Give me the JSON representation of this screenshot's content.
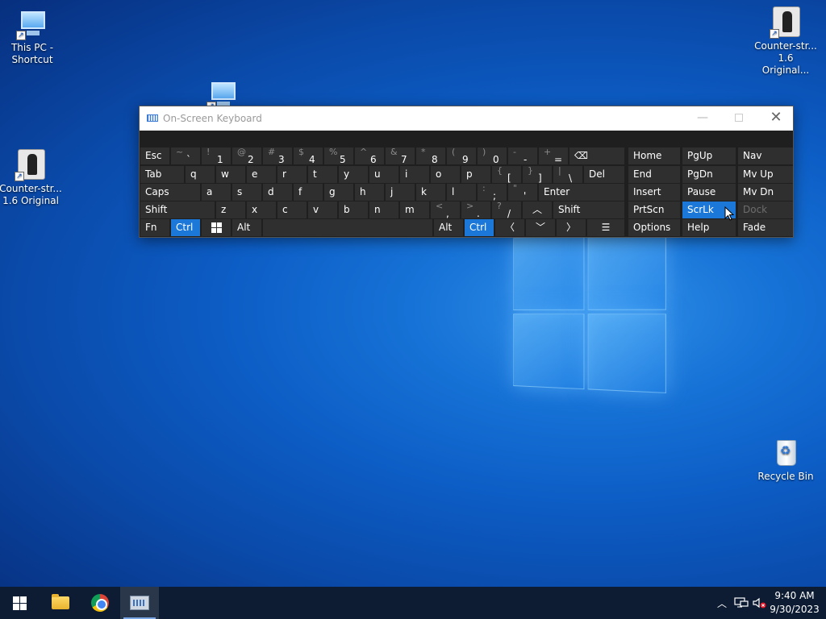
{
  "desktop": {
    "icons": [
      {
        "label": "This PC -\nShortcut"
      },
      {
        "label": "Counter-str...\n1.6 Original"
      },
      {
        "label": "Counter-str...\n1.6 Original..."
      },
      {
        "label": "Recycle Bin"
      }
    ]
  },
  "osk": {
    "title": "On-Screen Keyboard",
    "minimize_glyph": "—",
    "close_glyph": "✕",
    "keys": {
      "esc": "Esc",
      "tilde": {
        "sec": "~",
        "pri": "`"
      },
      "k1": {
        "sec": "!",
        "pri": "1"
      },
      "k2": {
        "sec": "@",
        "pri": "2"
      },
      "k3": {
        "sec": "#",
        "pri": "3"
      },
      "k4": {
        "sec": "$",
        "pri": "4"
      },
      "k5": {
        "sec": "%",
        "pri": "5"
      },
      "k6": {
        "sec": "^",
        "pri": "6"
      },
      "k7": {
        "sec": "&",
        "pri": "7"
      },
      "k8": {
        "sec": "*",
        "pri": "8"
      },
      "k9": {
        "sec": "(",
        "pri": "9"
      },
      "k0": {
        "sec": ")",
        "pri": "0"
      },
      "minus": {
        "sec": "-",
        "pri": "-"
      },
      "equals": {
        "sec": "+",
        "pri": "="
      },
      "backspace_glyph": "⌫",
      "tab": "Tab",
      "q": "q",
      "w": "w",
      "e": "e",
      "r": "r",
      "t": "t",
      "y": "y",
      "u": "u",
      "i": "i",
      "o": "o",
      "p": "p",
      "lbracket": {
        "sec": "{",
        "pri": "["
      },
      "rbracket": {
        "sec": "}",
        "pri": "]"
      },
      "backslash": {
        "sec": "|",
        "pri": "\\"
      },
      "del": "Del",
      "caps": "Caps",
      "a": "a",
      "s": "s",
      "d": "d",
      "f": "f",
      "g": "g",
      "h": "h",
      "j": "j",
      "k": "k",
      "l": "l",
      "semicolon": {
        "sec": ":",
        "pri": ";"
      },
      "quote": {
        "sec": "\"",
        "pri": "'"
      },
      "enter": "Enter",
      "shift_left": "Shift",
      "z": "z",
      "x": "x",
      "c": "c",
      "v": "v",
      "b": "b",
      "n": "n",
      "m": "m",
      "comma": {
        "sec": "<",
        "pri": ","
      },
      "period": {
        "sec": ">",
        "pri": "."
      },
      "slash": {
        "sec": "?",
        "pri": "/"
      },
      "up_glyph": "︿",
      "shift_right": "Shift",
      "fn": "Fn",
      "ctrl_left": "Ctrl",
      "alt_left": "Alt",
      "alt_right": "Alt",
      "ctrl_right": "Ctrl",
      "left_glyph": "〈",
      "down_glyph": "﹀",
      "right_glyph": "〉",
      "menu_glyph": "☰",
      "home": "Home",
      "pgup": "PgUp",
      "nav": "Nav",
      "end": "End",
      "pgdn": "PgDn",
      "mvup": "Mv Up",
      "insert": "Insert",
      "pause": "Pause",
      "mvdn": "Mv Dn",
      "prtscn": "PrtScn",
      "scrlk": "ScrLk",
      "dock": "Dock",
      "options": "Options",
      "help": "Help",
      "fade": "Fade"
    }
  },
  "taskbar": {
    "tray_chevron": "︿",
    "clock_time": "9:40 AM",
    "clock_date": "9/30/2023"
  },
  "colors": {
    "accent": "#1b78d8",
    "osk_bg": "#1f1f1f",
    "key_bg": "#2f2f2f",
    "taskbar": "#0d1c33"
  }
}
